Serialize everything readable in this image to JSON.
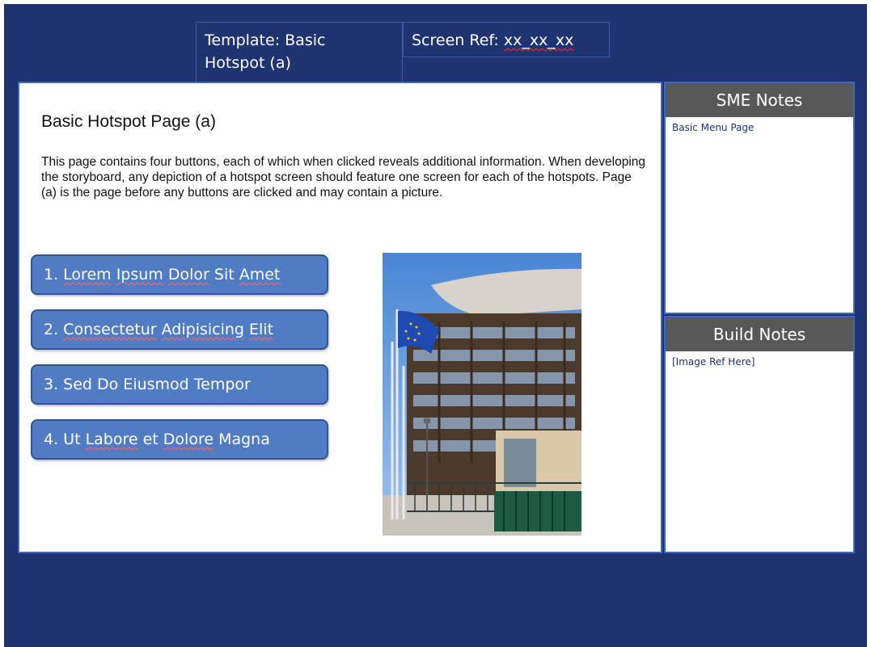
{
  "header": {
    "template_line1": "Template: Basic",
    "template_line2": "Hotspot (a)",
    "screen_ref_label": "Screen Ref: ",
    "screen_ref_value": "xx_xx_xx"
  },
  "page": {
    "title": "Basic Hotspot Page (a)",
    "description": "This page contains four buttons, each of which when clicked reveals additional information. When developing the storyboard, any depiction of a hotspot screen should feature one screen for each of the hotspots. Page (a) is the page before any buttons are clicked and may contain a picture."
  },
  "hotspots": [
    {
      "label": "1. Lorem Ipsum Dolor Sit Amet"
    },
    {
      "label": "2. Consectetur Adipisicing Elit"
    },
    {
      "label": "3. Sed Do Eiusmod Tempor"
    },
    {
      "label": "4. Ut Labore et Dolore Magna"
    }
  ],
  "sme_notes": {
    "heading": "SME Notes",
    "text": "Basic Menu Page"
  },
  "build_notes": {
    "heading": "Build Notes",
    "text": "[Image Ref Here]"
  },
  "colors": {
    "background": "#1f3370",
    "button": "#4f7cc2",
    "notes_header": "#585858"
  }
}
